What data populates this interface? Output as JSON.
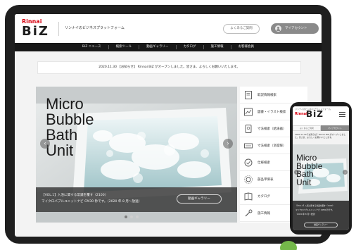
{
  "header": {
    "logo_top": "Rinnai",
    "logo_main": "BiZ",
    "tagline": "リンナイのビジネスプラットフォーム",
    "faq_label": "よくあるご質問",
    "account_label": "マイアカウント"
  },
  "nav": {
    "items": [
      "BiZ ニュース",
      "検索ツール",
      "動画ギャラリー",
      "カタログ",
      "施工情報",
      "お客様会員"
    ]
  },
  "notice": {
    "text": "2020.11.30 【お知らせ】 Rinnai BiZ がオープンしました。皆さま、よろしくお願いいたします。"
  },
  "hero": {
    "title_lines": [
      "Micro",
      "Bubble",
      "Bath",
      "Unit"
    ],
    "caption_line1": "【VOL.1】入浴に関する常識を覆す〈2100〉",
    "caption_line2": "マイクロバブルユニットナビ CM30 秒です。（2020 年 8 月〜放送）",
    "button_label": "動画ギャラリー",
    "prev_arrow": "‹",
    "next_arrow": "›",
    "slide_count": 3,
    "active_slide": 1
  },
  "side_menu": {
    "items": [
      {
        "label": "取説情報検索",
        "icon": "book-icon"
      },
      {
        "label": "図書・イラスト検索",
        "icon": "drawing-icon"
      },
      {
        "label": "寸法検索（給湯器）",
        "icon": "water-heater-icon"
      },
      {
        "label": "寸法検索（浴室暖）",
        "icon": "bath-heater-icon"
      },
      {
        "label": "仕様検索",
        "icon": "spec-icon"
      },
      {
        "label": "部品単価表",
        "icon": "parts-icon"
      },
      {
        "label": "カタログ",
        "icon": "catalog-icon"
      },
      {
        "label": "施工情報",
        "icon": "tools-icon"
      }
    ]
  },
  "phone": {
    "tagline": "リンナイのビジネスプラットフォーム",
    "logo_top": "Rinnai",
    "logo_main": "BiZ",
    "faq_label": "よくあるご質問",
    "account_label": "マイアカウント",
    "notice_text": "2020.11.30【お知らせ】Rinnai BiZ がオープンしました。皆さま、よろしくお願いいたします。",
    "title_lines": [
      "Micro",
      "Bubble",
      "Bath",
      "Unit"
    ],
    "caption_line1": "【VOL.1】入浴に関する常識を覆す〈2100〉",
    "caption_line2": "マイクロバブルユニットナビ CM30 秒です。",
    "caption_line3": "（2020 年 8 月〜放送）",
    "button_label": "動画ギャラリー"
  },
  "colors": {
    "brand_red": "#d7000f",
    "nav_bg": "#181818",
    "caption_bg": "#3c3c3c",
    "accent_green": "#74b84a"
  }
}
